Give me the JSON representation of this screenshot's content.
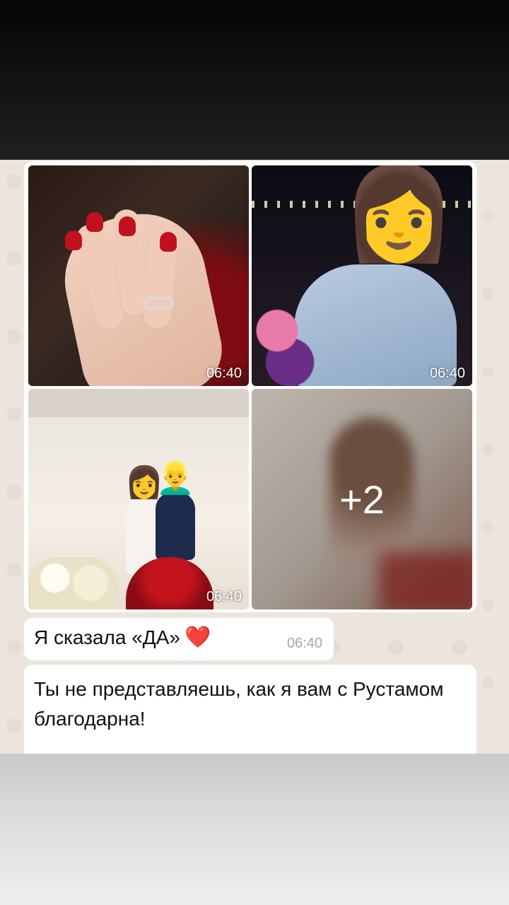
{
  "media": {
    "tiles": [
      {
        "time": "06:40",
        "emoji": ""
      },
      {
        "time": "06:40",
        "emoji": "👩"
      },
      {
        "time": "06:40",
        "emoji_left": "👩",
        "emoji_right": "👱‍♂️"
      },
      {
        "more_count": "+2"
      }
    ]
  },
  "messages": [
    {
      "text": "Я сказала «ДА»",
      "emoji": "❤️",
      "time": "06:40"
    },
    {
      "text": "Ты не представляешь, как я вам с Рустамом благодарна!"
    }
  ],
  "colors": {
    "bubble": "#ffffff",
    "chat_background": "#ebe5dd",
    "timestamp": "#a7a7a7"
  }
}
